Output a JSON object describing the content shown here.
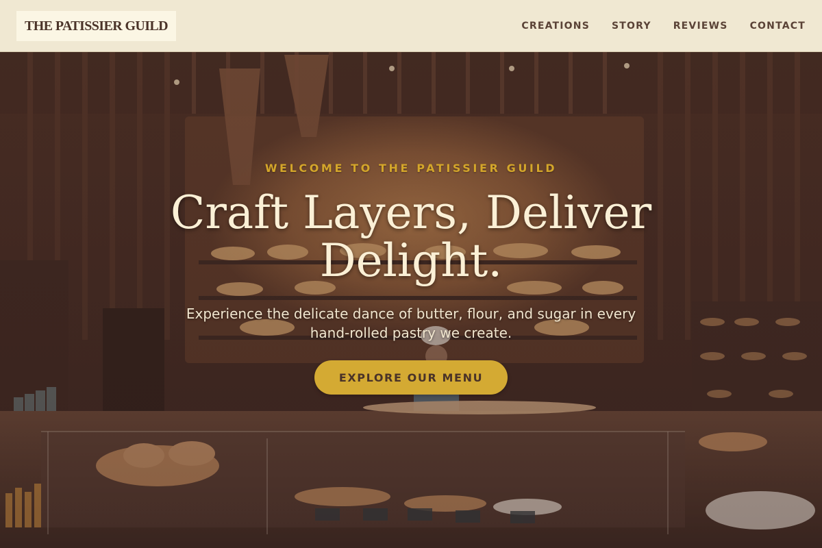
{
  "header": {
    "logo": "THE PATISSIER GUILD",
    "nav": [
      {
        "label": "CREATIONS"
      },
      {
        "label": "STORY"
      },
      {
        "label": "REVIEWS"
      },
      {
        "label": "CONTACT"
      }
    ]
  },
  "hero": {
    "eyebrow": "WELCOME TO THE PATISSIER GUILD",
    "headline": "Craft Layers, Deliver Delight.",
    "subtext": "Experience the delicate dance of butter, flour, and sugar in every hand-rolled pastry we create.",
    "cta_label": "EXPLORE OUR MENU"
  },
  "colors": {
    "header_bg": "#f0e8d2",
    "accent_gold": "#d4aa33",
    "text_dark": "#4a3328",
    "hero_text": "#fbf0d6"
  }
}
